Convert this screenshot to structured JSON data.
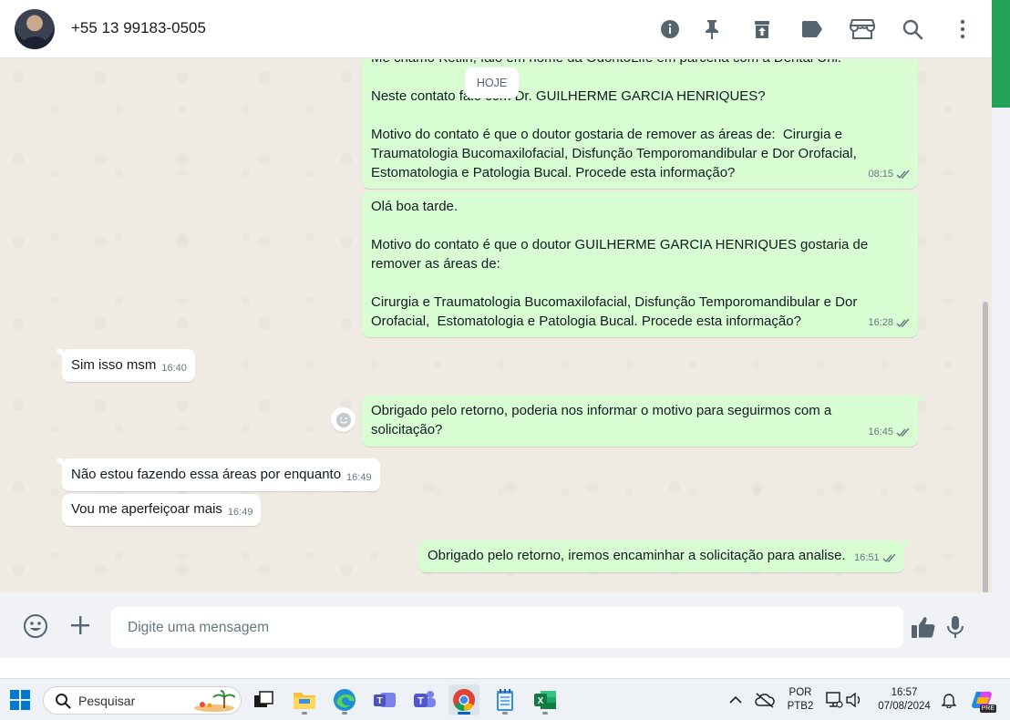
{
  "header": {
    "contact_name": "+55 13 99183-0505",
    "icons": [
      "info-icon",
      "pin-icon",
      "archive-icon",
      "label-icon",
      "store-icon",
      "search-icon",
      "more-vertical-icon"
    ]
  },
  "chat": {
    "date_chip": "HOJE",
    "messages": [
      {
        "direction": "out",
        "lines": [
          "Me chamo Ketlin, falo em nome da OdontoLife em parceria com a Dental Uni.",
          "",
          "Neste contato falo com Dr. GUILHERME GARCIA HENRIQUES?",
          "",
          "Motivo do contato é que o doutor gostaria de remover as áreas de:  Cirurgia e",
          "Traumatologia Bucomaxilofacial, Disfunção Temporomandibular e Dor Orofacial,",
          "Estomatologia e Patologia Bucal. Procede esta informação?"
        ],
        "time": "08:15"
      },
      {
        "direction": "out",
        "lines": [
          "Olá boa tarde.",
          "",
          "Motivo do contato é que o doutor GUILHERME GARCIA HENRIQUES gostaria de",
          "remover as áreas de:",
          "",
          "Cirurgia e Traumatologia Bucomaxilofacial, Disfunção Temporomandibular e Dor",
          "Orofacial,  Estomatologia e Patologia Bucal. Procede esta informação?"
        ],
        "time": "16:28"
      },
      {
        "direction": "in",
        "text": "Sim isso msm",
        "time": "16:40"
      },
      {
        "direction": "out",
        "lines": [
          "Obrigado pelo retorno, poderia nos informar o motivo para seguirmos com a",
          "solicitação?"
        ],
        "time": "16:45"
      },
      {
        "direction": "in",
        "text": "Não estou fazendo essa áreas por enquanto",
        "time": "16:49"
      },
      {
        "direction": "in",
        "text": "Vou me aperfeiçoar mais",
        "time": "16:49"
      },
      {
        "direction": "out",
        "text": "Obrigado pelo retorno, iremos encaminhar a solicitação para analise.",
        "time": "16:51"
      }
    ]
  },
  "compose": {
    "placeholder": "Digite uma mensagem"
  },
  "taskbar": {
    "search_label": "Pesquisar",
    "language": "POR",
    "layout": "PTB2",
    "time": "16:57",
    "date": "07/08/2024",
    "copilot_badge": "PRE"
  },
  "colors": {
    "outgoing_bubble": "#d9fdd3",
    "incoming_bubble": "#ffffff",
    "chat_background": "#efeae2",
    "accent_green": "#25a35a"
  }
}
